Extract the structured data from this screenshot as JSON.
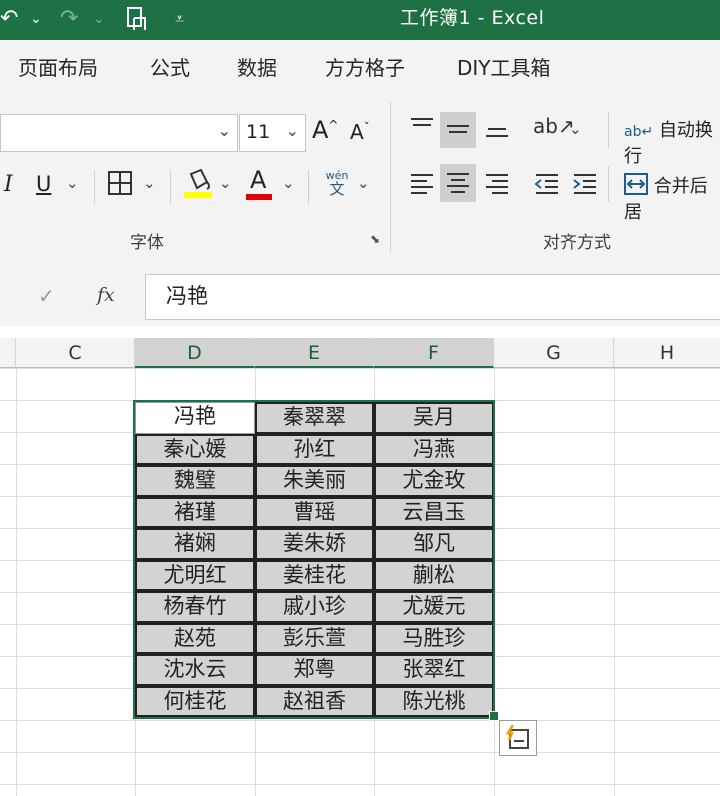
{
  "title_bar": {
    "title": "工作簿1  -  Excel",
    "icons": [
      "undo-icon",
      "redo-icon",
      "touch-mode-icon",
      "customize-qat-icon"
    ]
  },
  "tabs": [
    "页面布局",
    "公式",
    "数据",
    "方方格子",
    "DIY工具箱"
  ],
  "ribbon": {
    "font_size": "11",
    "font_group_label": "字体",
    "align_group_label": "对齐方式",
    "wrap_text_label": "自动换行",
    "merge_label": "合并后居",
    "grow_font": "A",
    "shrink_font": "A",
    "italic": "I",
    "underline": "U",
    "font_color_letter": "A",
    "phonetic_top": "wén",
    "phonetic_bottom": "文",
    "fill_color": "#ffff00",
    "font_color": "#e00000"
  },
  "formula_bar": {
    "fx": "fx",
    "value": "冯艳"
  },
  "sheet": {
    "columns": [
      "C",
      "D",
      "E",
      "F",
      "G",
      "H"
    ],
    "selected_columns": [
      "D",
      "E",
      "F"
    ],
    "rows": [
      [
        "冯艳",
        "秦翠翠",
        "吴月"
      ],
      [
        "秦心媛",
        "孙红",
        "冯燕"
      ],
      [
        "魏璧",
        "朱美丽",
        "尤金玫"
      ],
      [
        "褚瑾",
        "曹瑶",
        "云昌玉"
      ],
      [
        "褚娴",
        "姜朱娇",
        "邹凡"
      ],
      [
        "尤明红",
        "姜桂花",
        "蒯松"
      ],
      [
        "杨春竹",
        "戚小珍",
        "尤媛元"
      ],
      [
        "赵苑",
        "彭乐萱",
        "马胜珍"
      ],
      [
        "沈水云",
        "郑粤",
        "张翠红"
      ],
      [
        "何桂花",
        "赵祖香",
        "陈光桃"
      ]
    ],
    "accent": "#1e7145"
  }
}
